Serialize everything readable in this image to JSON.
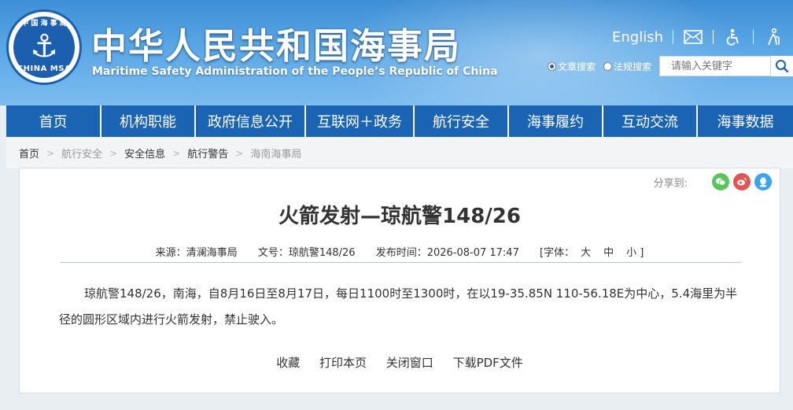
{
  "header": {
    "logo": {
      "ring_top": "中 国 海 事 局",
      "ring_bottom": "CHINA MSA"
    },
    "title": "中华人民共和国海事局",
    "subtitle": "Maritime Safety Administration of the People’s Republic of China",
    "english_link": "English",
    "icons": [
      "mail-icon",
      "accessibility-icon",
      "elderly-care-icon"
    ],
    "search": {
      "options": [
        {
          "label": "文章搜索",
          "selected": true
        },
        {
          "label": "法规搜索",
          "selected": false
        }
      ],
      "placeholder": "请输入关键字"
    }
  },
  "nav": {
    "items": [
      "首页",
      "机构职能",
      "政府信息公开",
      "互联网＋政务",
      "航行安全",
      "海事履约",
      "互动交流",
      "海事数据"
    ]
  },
  "breadcrumb": [
    "首页",
    "航行安全",
    "安全信息",
    "航行警告",
    "海南海事局"
  ],
  "article": {
    "share_label": "分享到:",
    "share_icons": [
      "wechat-icon",
      "weibo-icon",
      "qq-icon"
    ],
    "title": "火箭发射—琼航警148/26",
    "meta": {
      "source": "来源：清澜海事局",
      "doc_no": "文号：琼航警148/26",
      "publish_time": "发布时间：2026-08-07 17:47",
      "font_label": "[字体：",
      "font_large": "大",
      "font_medium": "中",
      "font_small": "小 ]"
    },
    "body": "琼航警148/26，南海，自8月16日至8月17日，每日1100时至1300时，在以19-35.85N 110-56.18E为中心，5.4海里为半径的圆形区域内进行火箭发射，禁止驶入。",
    "actions": [
      "收藏",
      "打印本页",
      "关闭窗口",
      "下载PDF文件"
    ]
  },
  "colors": {
    "nav_blue": "#1b64b3",
    "wechat": "#5bc55a",
    "weibo": "#e3564f",
    "qq": "#3aa4ec"
  }
}
